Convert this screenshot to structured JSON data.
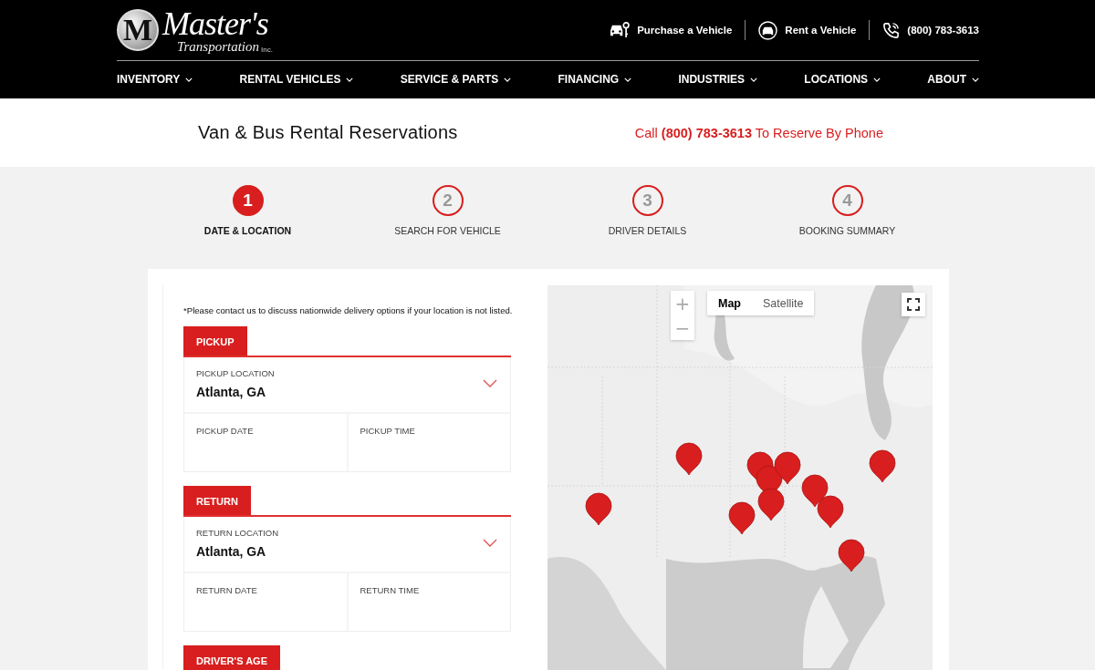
{
  "logo": {
    "letter": "M",
    "name": "Master's",
    "sub": "Transportation",
    "suffix": "Inc."
  },
  "top_links": [
    {
      "kind": "purchase",
      "label": "Purchase a Vehicle"
    },
    {
      "kind": "rent",
      "label": "Rent a Vehicle"
    },
    {
      "kind": "phone",
      "label": "(800) 783-3613"
    }
  ],
  "nav": [
    "INVENTORY",
    "RENTAL VEHICLES",
    "SERVICE & PARTS",
    "FINANCING",
    "INDUSTRIES",
    "LOCATIONS",
    "ABOUT"
  ],
  "page_title": "Van & Bus Rental Reservations",
  "call_line": "Call **(800) 783-3613** To Reserve By Phone",
  "steps": [
    {
      "number": "1",
      "label": "DATE & LOCATION",
      "selected": true
    },
    {
      "number": "2",
      "label": "SEARCH FOR VEHICLE",
      "selected": false
    },
    {
      "number": "3",
      "label": "DRIVER DETAILS",
      "selected": false
    },
    {
      "number": "4",
      "label": "BOOKING SUMMARY",
      "selected": false
    }
  ],
  "notice": "*Please contact us to discuss nationwide delivery options if your location is not listed.",
  "sections": [
    {
      "title": "PICKUP",
      "location_label": "PICKUP LOCATION",
      "location_value": "Atlanta, GA",
      "date_label": "PICKUP DATE",
      "time_label": "PICKUP TIME"
    },
    {
      "title": "RETURN",
      "location_label": "RETURN LOCATION",
      "location_value": "Atlanta, GA",
      "date_label": "RETURN DATE",
      "time_label": "RETURN TIME"
    }
  ],
  "next_section": {
    "title": "DRIVER'S AGE"
  },
  "map": {
    "kind": "picture",
    "zoom_in": "+",
    "zoom_out": "−",
    "map_types": [
      {
        "label": "Map",
        "selected": true
      },
      {
        "label": "Satellite",
        "selected": false
      }
    ]
  }
}
